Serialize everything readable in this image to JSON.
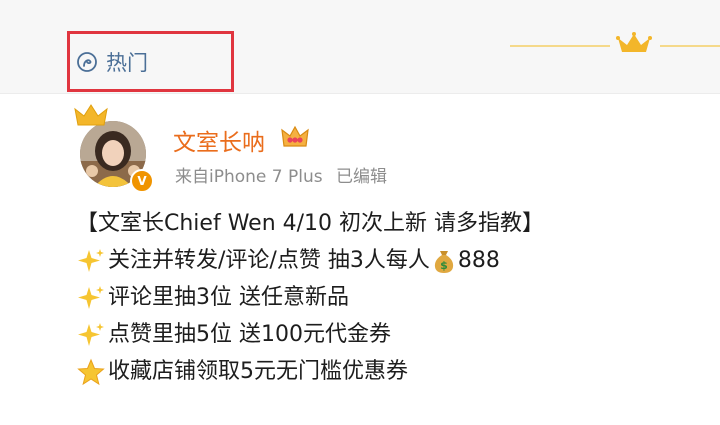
{
  "header": {
    "hot_label": "热门"
  },
  "post": {
    "username": "文室长呐",
    "source": "来自iPhone 7 Plus",
    "edited": "已编辑",
    "title_line": "【文室长Chief Wen 4/10 初次上新 请多指教】",
    "line1_text": "关注并转发/评论/点赞 抽3人每人",
    "line1_amount": "888",
    "line2_text": "评论里抽3位 送任意新品",
    "line3_text": "点赞里抽5位 送100元代金券",
    "line4_text": "收藏店铺领取5元无门槛优惠券"
  },
  "colors": {
    "highlight_border": "#e0353f",
    "link_blue": "#4b6f97",
    "username_orange": "#ea6d1c"
  }
}
